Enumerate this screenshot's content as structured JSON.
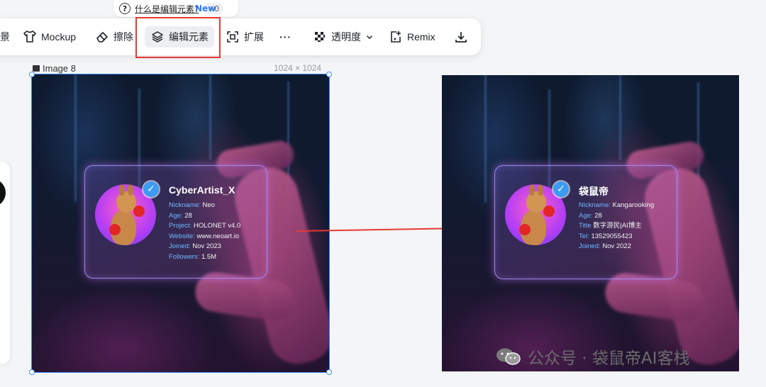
{
  "hint": {
    "question": "什么是编辑元素?",
    "credits": "0"
  },
  "toolbar": {
    "items": [
      {
        "label": "景"
      },
      {
        "label": "Mockup"
      },
      {
        "label": "擦除"
      },
      {
        "label": "编辑元素"
      },
      {
        "label": "扩展"
      },
      {
        "label": "···"
      },
      {
        "label": "透明度"
      },
      {
        "label": "Remix"
      }
    ],
    "new_badge": "New"
  },
  "canvas": {
    "image_name": "Image 8",
    "image_size": "1024 × 1024"
  },
  "left_card": {
    "title": "CyberArtist_X",
    "rows": [
      {
        "key": "Nickname:",
        "value": "Neo"
      },
      {
        "key": "Age:",
        "value": "28"
      },
      {
        "key": "Project:",
        "value": "HOLONET v4.0"
      },
      {
        "key": "Website:",
        "value": "www.neoart.io"
      },
      {
        "key": "Joined:",
        "value": "Nov 2023"
      },
      {
        "key": "Followers:",
        "value": "1.5M"
      }
    ]
  },
  "right_card": {
    "title": "袋鼠帝",
    "rows": [
      {
        "key": "Nickname:",
        "value": "Kangarooking"
      },
      {
        "key": "Age:",
        "value": "28"
      },
      {
        "key": "Title",
        "value": "数字游民|AI博主"
      },
      {
        "key": "Tel:",
        "value": "13529055423"
      },
      {
        "key": "Joined:",
        "value": "Nov 2022"
      }
    ]
  },
  "watermark": {
    "text": "公众号 · 袋鼠帝AI客栈"
  },
  "colors": {
    "accent": "#3b8df5",
    "highlight_box": "#e53935",
    "arrow": "#e53935",
    "new_badge": "#2f7cf6"
  },
  "icons": [
    "help-circle-icon",
    "bolt-icon",
    "shirt-icon",
    "eraser-icon",
    "layers-edit-icon",
    "expand-icon",
    "more-icon",
    "transparency-icon",
    "chevron-down-icon",
    "remix-icon",
    "download-icon",
    "image-icon",
    "verified-icon",
    "wechat-icon"
  ]
}
